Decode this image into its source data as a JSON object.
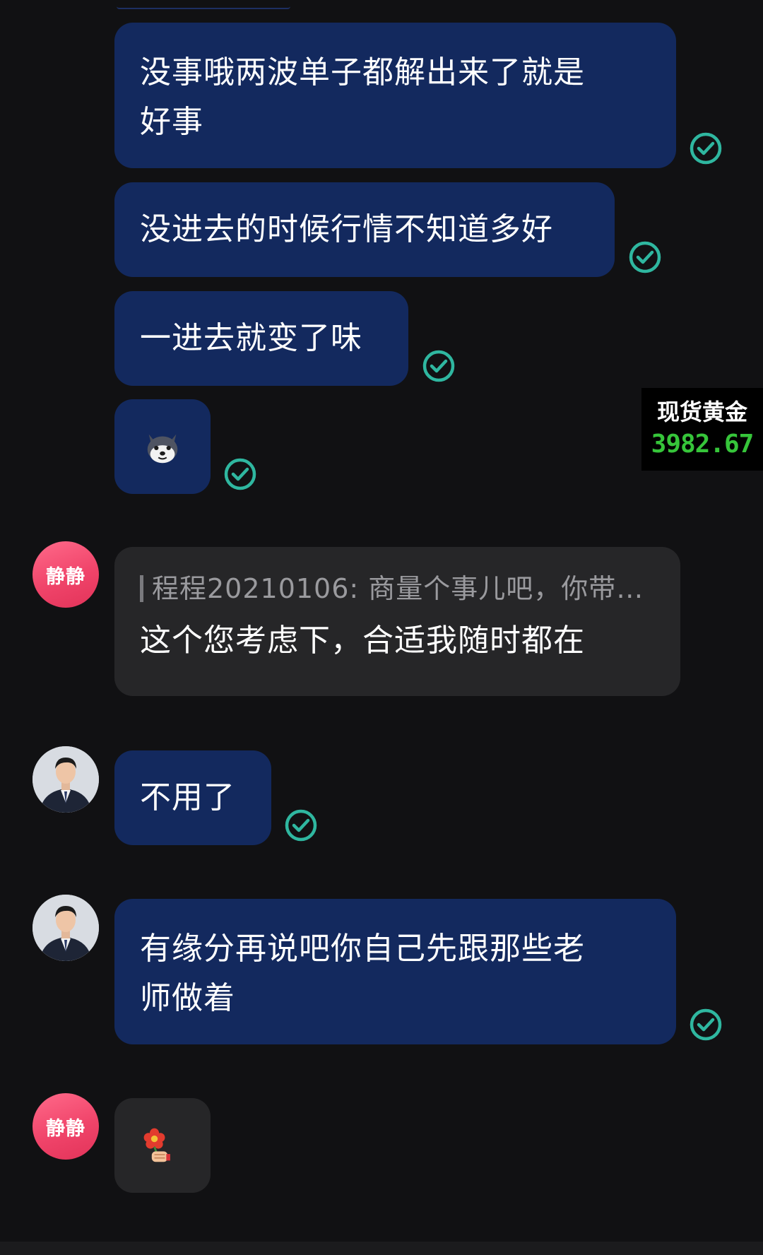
{
  "messages": [
    {
      "text_line1": "没事哦两波单子都解出来了就是",
      "text_line2": "好事",
      "status": "read"
    },
    {
      "text": "没进去的时候行情不知道多好",
      "status": "read"
    },
    {
      "text": "一进去就变了味",
      "status": "read"
    },
    {
      "sticker": "dog-face-emoji",
      "status": "read"
    },
    {
      "sender": "静静",
      "quote": "程程20210106: 商量个事儿吧，你带…",
      "text": "这个您考虑下，合适我随时都在"
    },
    {
      "text": "不用了",
      "status": "read"
    },
    {
      "text_line1": "有缘分再说吧你自己先跟那些老",
      "text_line2": "师做着",
      "status": "read"
    },
    {
      "sender": "静静",
      "sticker": "flower-gift-emoji"
    }
  ],
  "avatars": {
    "jing": "静静"
  },
  "gold_widget": {
    "title": "现货黄金",
    "price": "3982.67"
  },
  "colors": {
    "background": "#111113",
    "outgoing_bubble": "#13295e",
    "incoming_bubble": "#262628",
    "check": "#2fb7a0",
    "price_green": "#36c53a"
  }
}
